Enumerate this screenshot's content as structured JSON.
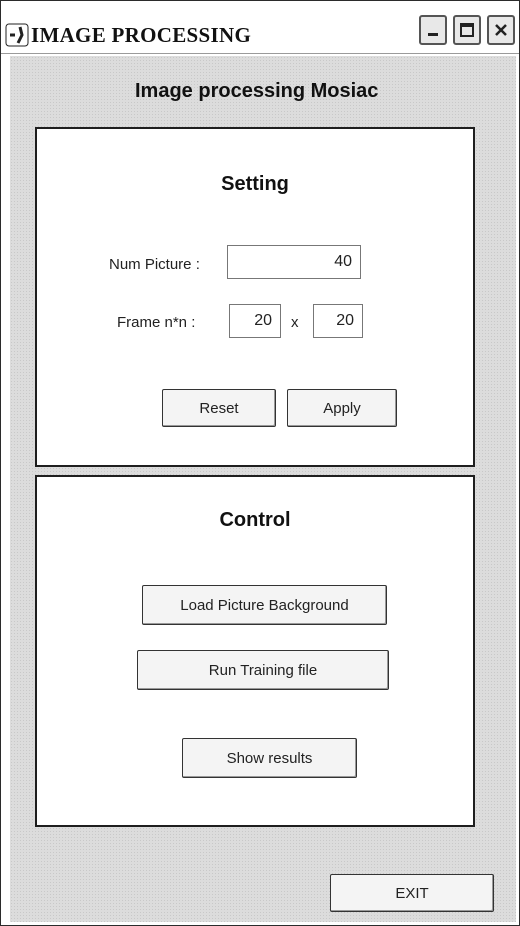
{
  "window": {
    "title": "IMAGE PROCESSING",
    "icons": [
      "app-icon",
      "minimize-icon",
      "maximize-icon",
      "close-icon"
    ]
  },
  "header": {
    "label": "Image processing Mosiac"
  },
  "setting": {
    "title": "Setting",
    "num_picture_label": "Num Picture :",
    "num_picture_value": "40",
    "frame_label": "Frame n*n :",
    "frame_w": "20",
    "frame_sep": "x",
    "frame_h": "20",
    "reset_label": "Reset",
    "apply_label": "Apply"
  },
  "control": {
    "title": "Control",
    "load_bg_label": "Load Picture Background",
    "run_training_label": "Run Training file",
    "show_results_label": "Show results"
  },
  "footer": {
    "exit_label": "EXIT"
  }
}
